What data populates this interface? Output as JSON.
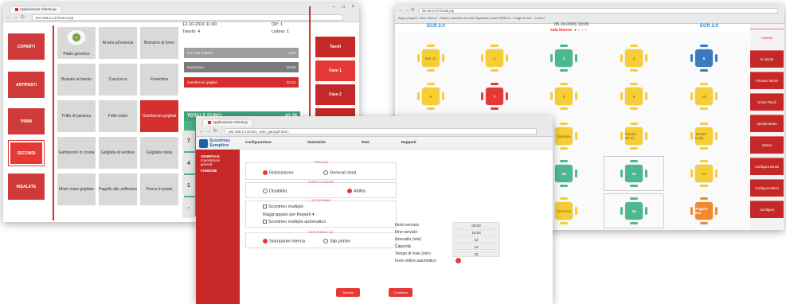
{
  "w1": {
    "tab_title": "Applicazione Cliente.jp",
    "url": "192.168.5.141/menu.jsp",
    "categories": [
      "COPERTI",
      "ANTIPASTI",
      "PRIMI",
      "SECONDI",
      "INSALATE"
    ],
    "dishes": [
      {
        "label": "Piatto generico"
      },
      {
        "label": "Anatra all'arancia"
      },
      {
        "label": "Branzino al forno"
      },
      {
        "label": "Brasato al barolo"
      },
      {
        "label": "Cacciucco"
      },
      {
        "label": "Fiorentina"
      },
      {
        "label": "Fritto di paranza"
      },
      {
        "label": "Fritto misto"
      },
      {
        "label": "Gamberoni grigliati"
      },
      {
        "label": "Gamberoni in crosta"
      },
      {
        "label": "Grigliata di verdure"
      },
      {
        "label": "Grigliata mista"
      },
      {
        "label": "Misto mare grigliato"
      },
      {
        "label": "Pagello allo zafferano"
      },
      {
        "label": "Pesce in pasta"
      }
    ],
    "order": {
      "datetime": "12-10-2016 11:00",
      "op": "OP: 1",
      "tavolo": "Tavolo: 4",
      "listino": "Listino: 1",
      "rows": [
        {
          "name": "2 x 0,50 Coperti",
          "price": "1,00"
        },
        {
          "name": "Cacciucco",
          "price": "18,19"
        },
        {
          "name": "Gamberoni grigliati",
          "price": "23,19"
        }
      ],
      "total_label": "TOTALE EURO:",
      "total_value": "42,38"
    },
    "side_numbers": [
      "7",
      "4",
      "1",
      "-"
    ],
    "right_buttons": [
      "Tavoli",
      "Fase 1",
      "Fase 2",
      "Variant"
    ]
  },
  "w2": {
    "tab_title": "Applicazione Clienti.jp",
    "url": "192.168.5.141/sec_web_gauog/Fase?",
    "logo_line1": "Scontrino",
    "logo_line2": "Semplice",
    "nav": [
      "Configurazione",
      "Statistiche",
      "Rete",
      "Rapporti"
    ],
    "side": [
      "GENERALE",
      "Impostazioni",
      "general",
      "FONDOMI"
    ],
    "tipo_legend": "TIPO GUI",
    "tipo_opts": [
      "Ristorazione",
      "General retail"
    ],
    "conto_legend": "CONTO CLIENTE",
    "conto_opts": [
      "Disabilita",
      "Abilita"
    ],
    "scontrino_legend": "SCONTRINO",
    "scontrino_opts": [
      "Scontrino multiplo",
      "Raggruppato per Reparti",
      "Scontrino multiplo automatico"
    ],
    "fatt_legend": "FATT./RICEV. SU",
    "fatt_opts": [
      "Stampante interna",
      "Slip printer"
    ],
    "fields": [
      {
        "label": "Inizio servizio",
        "value": "09:00"
      },
      {
        "label": "Fine servizio",
        "value": "15:00"
      },
      {
        "label": "Intervallo (min)",
        "value": "12"
      },
      {
        "label": "Capacità",
        "value": "13"
      },
      {
        "label": "Tempo di invio (min)",
        "value": "15"
      }
    ],
    "auto_label": "Invio ordine automatico",
    "btn_cancel": "Annulla",
    "btn_confirm": "Conferma"
  },
  "w3": {
    "tab_title": "Applicazione",
    "url": "96.98.8.870/sala.jsp",
    "bookmarks": "Apps  progetti - Nexi  GitHub - Sliders  Gazzetta Scuola  Significato nomi  IMPEGA - Image  Ecwid - Control",
    "banner_left": "ECR 2.0",
    "banner_right": "ECR 2.0",
    "datetime": "05-10-2016 10:26",
    "room": "sala bianca",
    "tables": [
      {
        "label": "Bar 11",
        "color": "y"
      },
      {
        "label": "2",
        "color": "y"
      },
      {
        "label": "3",
        "color": "g"
      },
      {
        "label": "4",
        "color": "y"
      },
      {
        "label": "5",
        "color": "b"
      },
      {
        "label": "6",
        "color": "y"
      },
      {
        "label": "7",
        "color": "r"
      },
      {
        "label": "8",
        "color": "y"
      },
      {
        "label": "9",
        "color": "y"
      },
      {
        "label": "10",
        "color": "y"
      },
      {
        "label": "11",
        "color": "y"
      },
      {
        "label": "12",
        "color": "y"
      },
      {
        "label": "Giardino",
        "color": "y"
      },
      {
        "label": "Tavolo Wi-Fi",
        "color": "y"
      },
      {
        "label": "Tavolo Dalla",
        "color": "y"
      },
      {
        "label": "Tavolo Lungo",
        "color": "y"
      },
      {
        "label": "Sala Privata",
        "color": "gr"
      },
      {
        "label": "18",
        "color": "g"
      },
      {
        "label": "19",
        "color": "g"
      },
      {
        "label": "11",
        "color": "y"
      },
      {
        "label": "21",
        "color": "g"
      },
      {
        "label": "22",
        "color": "y"
      },
      {
        "label": "Terrazza",
        "color": "y"
      },
      {
        "label": "19",
        "color": "g"
      },
      {
        "label": "Angolo Bar",
        "color": "o"
      }
    ],
    "right_buttons": [
      "Asporto",
      "In Uscita",
      "Prenota Tavolo",
      "Unisci Tavoli",
      "Sposta tavolo",
      "Storno",
      "Configura tavolo",
      "Configura Menù",
      "Configura"
    ]
  },
  "colors": {
    "accent": "#d32f2f",
    "green": "#4db38b",
    "blue": "#1e88e5"
  }
}
